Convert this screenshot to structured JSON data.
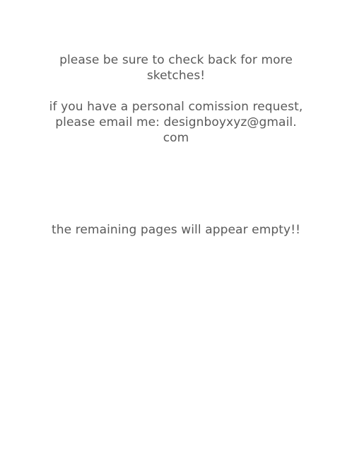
{
  "page": {
    "lines": {
      "check_back_1": "please be sure to check back for more",
      "check_back_2": "sketches!",
      "commission_1": "if you have a personal comission request,",
      "commission_2": "please email me: designboyxyz@gmail.",
      "commission_3": "com",
      "empty_notice": "the remaining pages will appear empty!!"
    }
  }
}
